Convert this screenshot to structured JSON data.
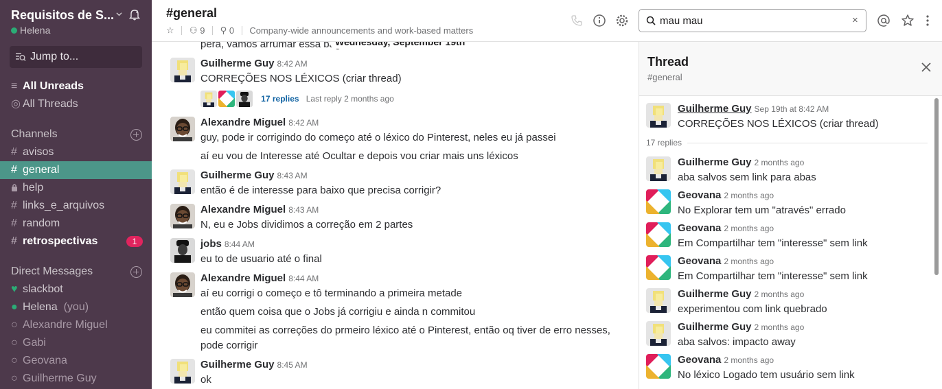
{
  "workspace": {
    "name": "Requisitos de S...",
    "user": "Helena"
  },
  "sidebar": {
    "jump_label": "Jump to...",
    "all_unreads": "All Unreads",
    "all_threads": "All Threads",
    "channels_header": "Channels",
    "channels": [
      {
        "prefix": "#",
        "name": "avisos"
      },
      {
        "prefix": "#",
        "name": "general"
      },
      {
        "prefix": "lock",
        "name": "help"
      },
      {
        "prefix": "#",
        "name": "links_e_arquivos"
      },
      {
        "prefix": "#",
        "name": "random"
      },
      {
        "prefix": "#",
        "name": "retrospectivas",
        "badge": "1"
      }
    ],
    "dm_header": "Direct Messages",
    "dms": [
      {
        "name": "slackbot"
      },
      {
        "name": "Helena",
        "suffix": "(you)"
      },
      {
        "name": "Alexandre Miguel"
      },
      {
        "name": "Gabi"
      },
      {
        "name": "Geovana"
      },
      {
        "name": "Guilherme Guy"
      }
    ]
  },
  "header": {
    "channel": "#general",
    "members": "9",
    "pins": "0",
    "topic": "Company-wide announcements and work-based matters",
    "search_value": "mau mau",
    "search_clear": "×"
  },
  "messages": {
    "partial_text": "pera, vamos arrumar essa bag",
    "date_divider": "Wednesday, September 19th",
    "items": [
      {
        "author": "Guilherme Guy",
        "time": "8:42 AM",
        "text": "CORREÇÕES NOS LÉXICOS",
        "text_suffix": " (criar thread)"
      },
      {
        "author": "Alexandre Miguel",
        "time": "8:42 AM",
        "lines": [
          "guy, pode ir corrigindo do começo até o léxico do Pinterest, neles eu já passei",
          "aí eu vou de Interesse até Ocultar e depois vou criar mais uns léxicos"
        ]
      },
      {
        "author": "Guilherme Guy",
        "time": "8:43 AM",
        "lines": [
          "então é de interesse para baixo que precisa corrigir?"
        ]
      },
      {
        "author": "Alexandre Miguel",
        "time": "8:43 AM",
        "lines": [
          "N, eu e Jobs dividimos a correção em 2 partes"
        ]
      },
      {
        "author": "jobs",
        "time": "8:44 AM",
        "lines": [
          "eu to de usuario até o final"
        ]
      },
      {
        "author": "Alexandre Miguel",
        "time": "8:44 AM",
        "lines": [
          "aí eu corrigi o começo e tô terminando a primeira metade",
          "então quem coisa que o Jobs já corrigiu e ainda n commitou",
          "eu commitei as correções do prmeiro léxico até o Pinterest, então oq tiver de erro nesses,",
          "pode corrigir"
        ]
      },
      {
        "author": "Guilherme Guy",
        "time": "8:45 AM",
        "lines": [
          "ok"
        ]
      }
    ],
    "reply_count": "17 replies",
    "last_reply": "Last reply 2 months ago"
  },
  "thread": {
    "title": "Thread",
    "channel": "#general",
    "parent": {
      "author": "Guilherme Guy",
      "time": "Sep 19th at 8:42 AM",
      "text": "CORREÇÕES NOS LÉXICOS",
      "text_suffix": " (criar thread)"
    },
    "replies_label": "17 replies",
    "replies": [
      {
        "author": "Guilherme Guy",
        "time": "2 months ago",
        "text": "aba salvos sem link para abas"
      },
      {
        "author": "Geovana",
        "time": "2 months ago",
        "text": "No Explorar tem um \"através\" errado"
      },
      {
        "author": "Geovana",
        "time": "2 months ago",
        "text": "Em Compartilhar tem \"interesse\" sem link"
      },
      {
        "author": "Geovana",
        "time": "2 months ago",
        "text": "Em Compartilhar tem \"interesse\" sem link"
      },
      {
        "author": "Guilherme Guy",
        "time": "2 months ago",
        "text": "experimentou com link quebrado"
      },
      {
        "author": "Guilherme Guy",
        "time": "2 months ago",
        "text": "aba salvos: impacto away"
      },
      {
        "author": "Geovana",
        "time": "2 months ago",
        "text": "No léxico Logado tem usuário sem link"
      }
    ]
  },
  "colors": {
    "sidebar": "#4d394b",
    "active": "#4c9689",
    "badge": "#e0245e",
    "link": "#1264a3"
  }
}
